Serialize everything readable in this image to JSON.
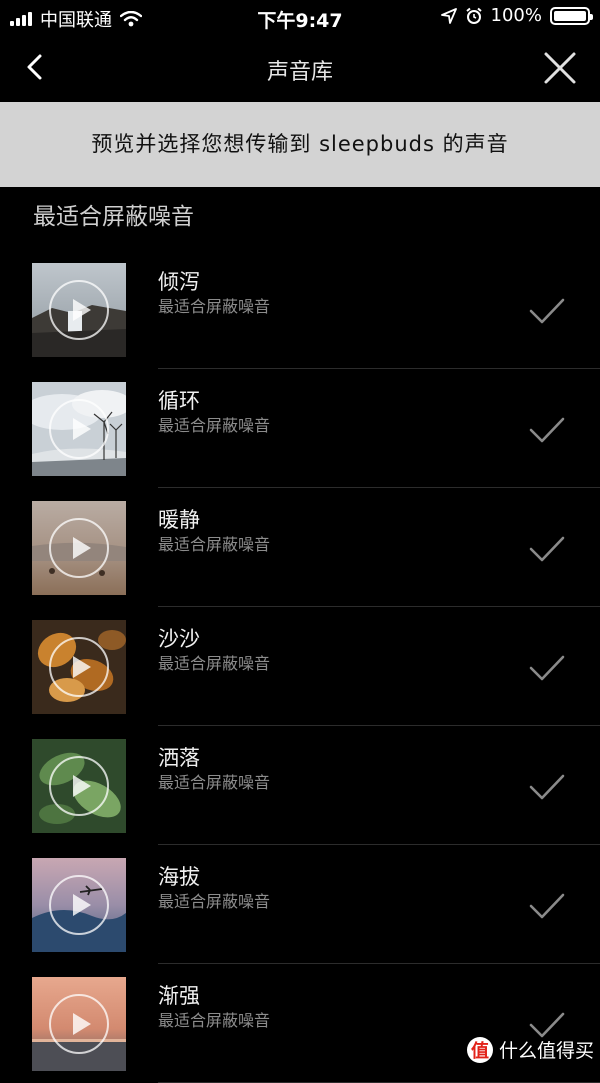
{
  "status_bar": {
    "carrier": "中国联通",
    "time": "下午9:47",
    "battery": "100%",
    "battery_level": 1.0,
    "icons": [
      "signal-icon",
      "wifi-icon",
      "location-icon",
      "alarm-icon",
      "battery-icon"
    ]
  },
  "nav": {
    "title": "声音库",
    "back_icon": "chevron-left-icon",
    "close_icon": "close-icon"
  },
  "banner": {
    "text": "预览并选择您想传输到 sleepbuds 的声音"
  },
  "section": {
    "title": "最适合屏蔽噪音"
  },
  "sounds": [
    {
      "name": "倾泻",
      "subtitle": "最适合屏蔽噪音",
      "thumb": "waterfall",
      "checked": true
    },
    {
      "name": "循环",
      "subtitle": "最适合屏蔽噪音",
      "thumb": "wind-turbines",
      "checked": true
    },
    {
      "name": "暖静",
      "subtitle": "最适合屏蔽噪音",
      "thumb": "foggy-field",
      "checked": true
    },
    {
      "name": "沙沙",
      "subtitle": "最适合屏蔽噪音",
      "thumb": "autumn-leaves",
      "checked": true
    },
    {
      "name": "洒落",
      "subtitle": "最适合屏蔽噪音",
      "thumb": "green-leaves",
      "checked": true
    },
    {
      "name": "海拔",
      "subtitle": "最适合屏蔽噪音",
      "thumb": "airplane-sky",
      "checked": true
    },
    {
      "name": "渐强",
      "subtitle": "最适合屏蔽噪音",
      "thumb": "sunset-sea",
      "checked": true
    }
  ],
  "watermark": {
    "logo": "值",
    "text": "什么值得买"
  },
  "colors": {
    "background": "#000000",
    "banner": "#d3d3d3",
    "subtitle": "#8c8c8c",
    "check": "#8a8a8a"
  }
}
